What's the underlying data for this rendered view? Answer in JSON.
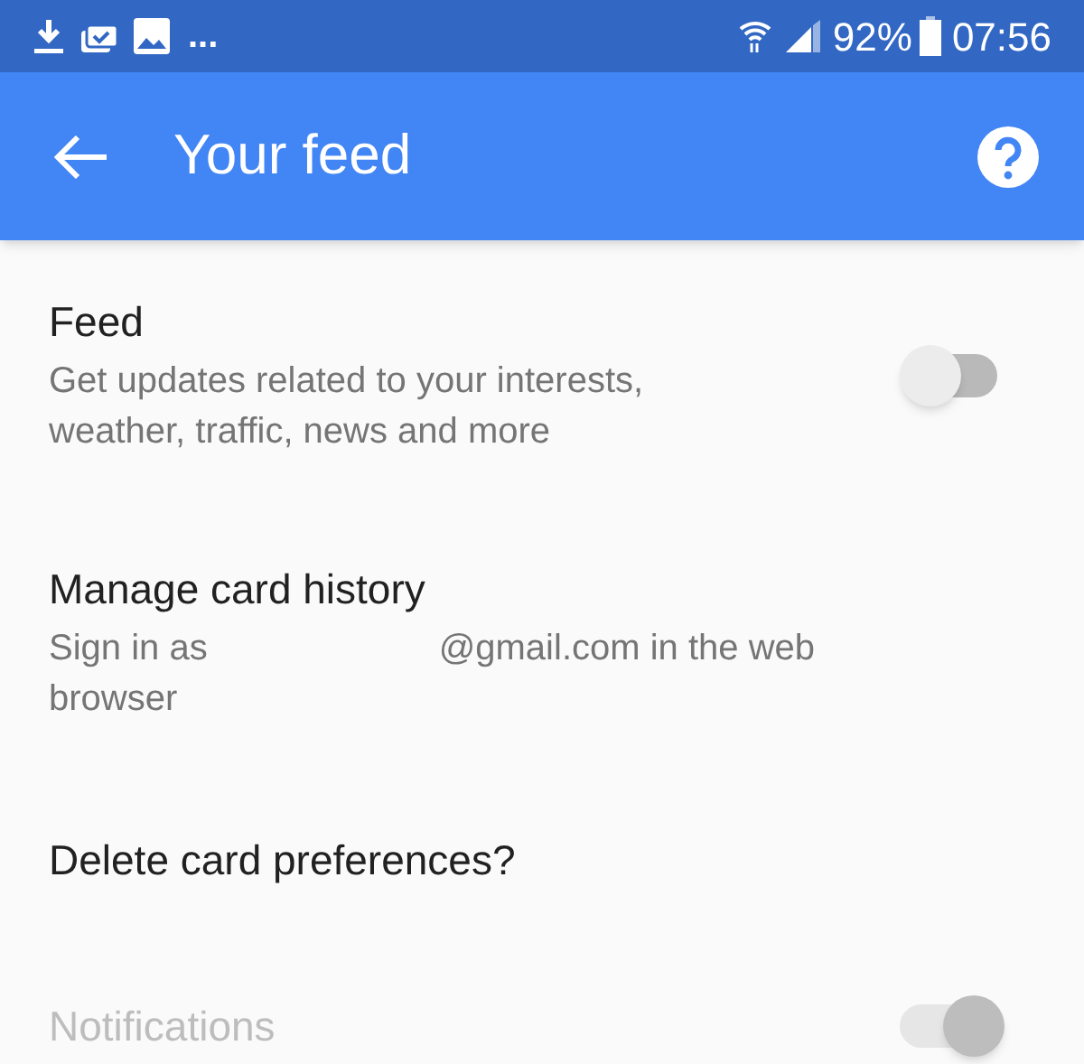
{
  "status_bar": {
    "notifications": "...",
    "battery": "92%",
    "time": "07:56"
  },
  "toolbar": {
    "title": "Your feed"
  },
  "settings": [
    {
      "kind": "switch",
      "title": "Feed",
      "subtitle": "Get updates related to your interests, weather, traffic, news and more",
      "on": false,
      "disabled": false
    },
    {
      "kind": "account",
      "title": "Manage card history",
      "subtitle_start": "Sign in as",
      "subtitle_end": "@gmail.com in the web browser",
      "disabled": false
    },
    {
      "kind": "plain",
      "title": "Delete card preferences?",
      "disabled": false
    },
    {
      "kind": "switch",
      "title": "Notifications",
      "on": true,
      "disabled": true
    }
  ]
}
